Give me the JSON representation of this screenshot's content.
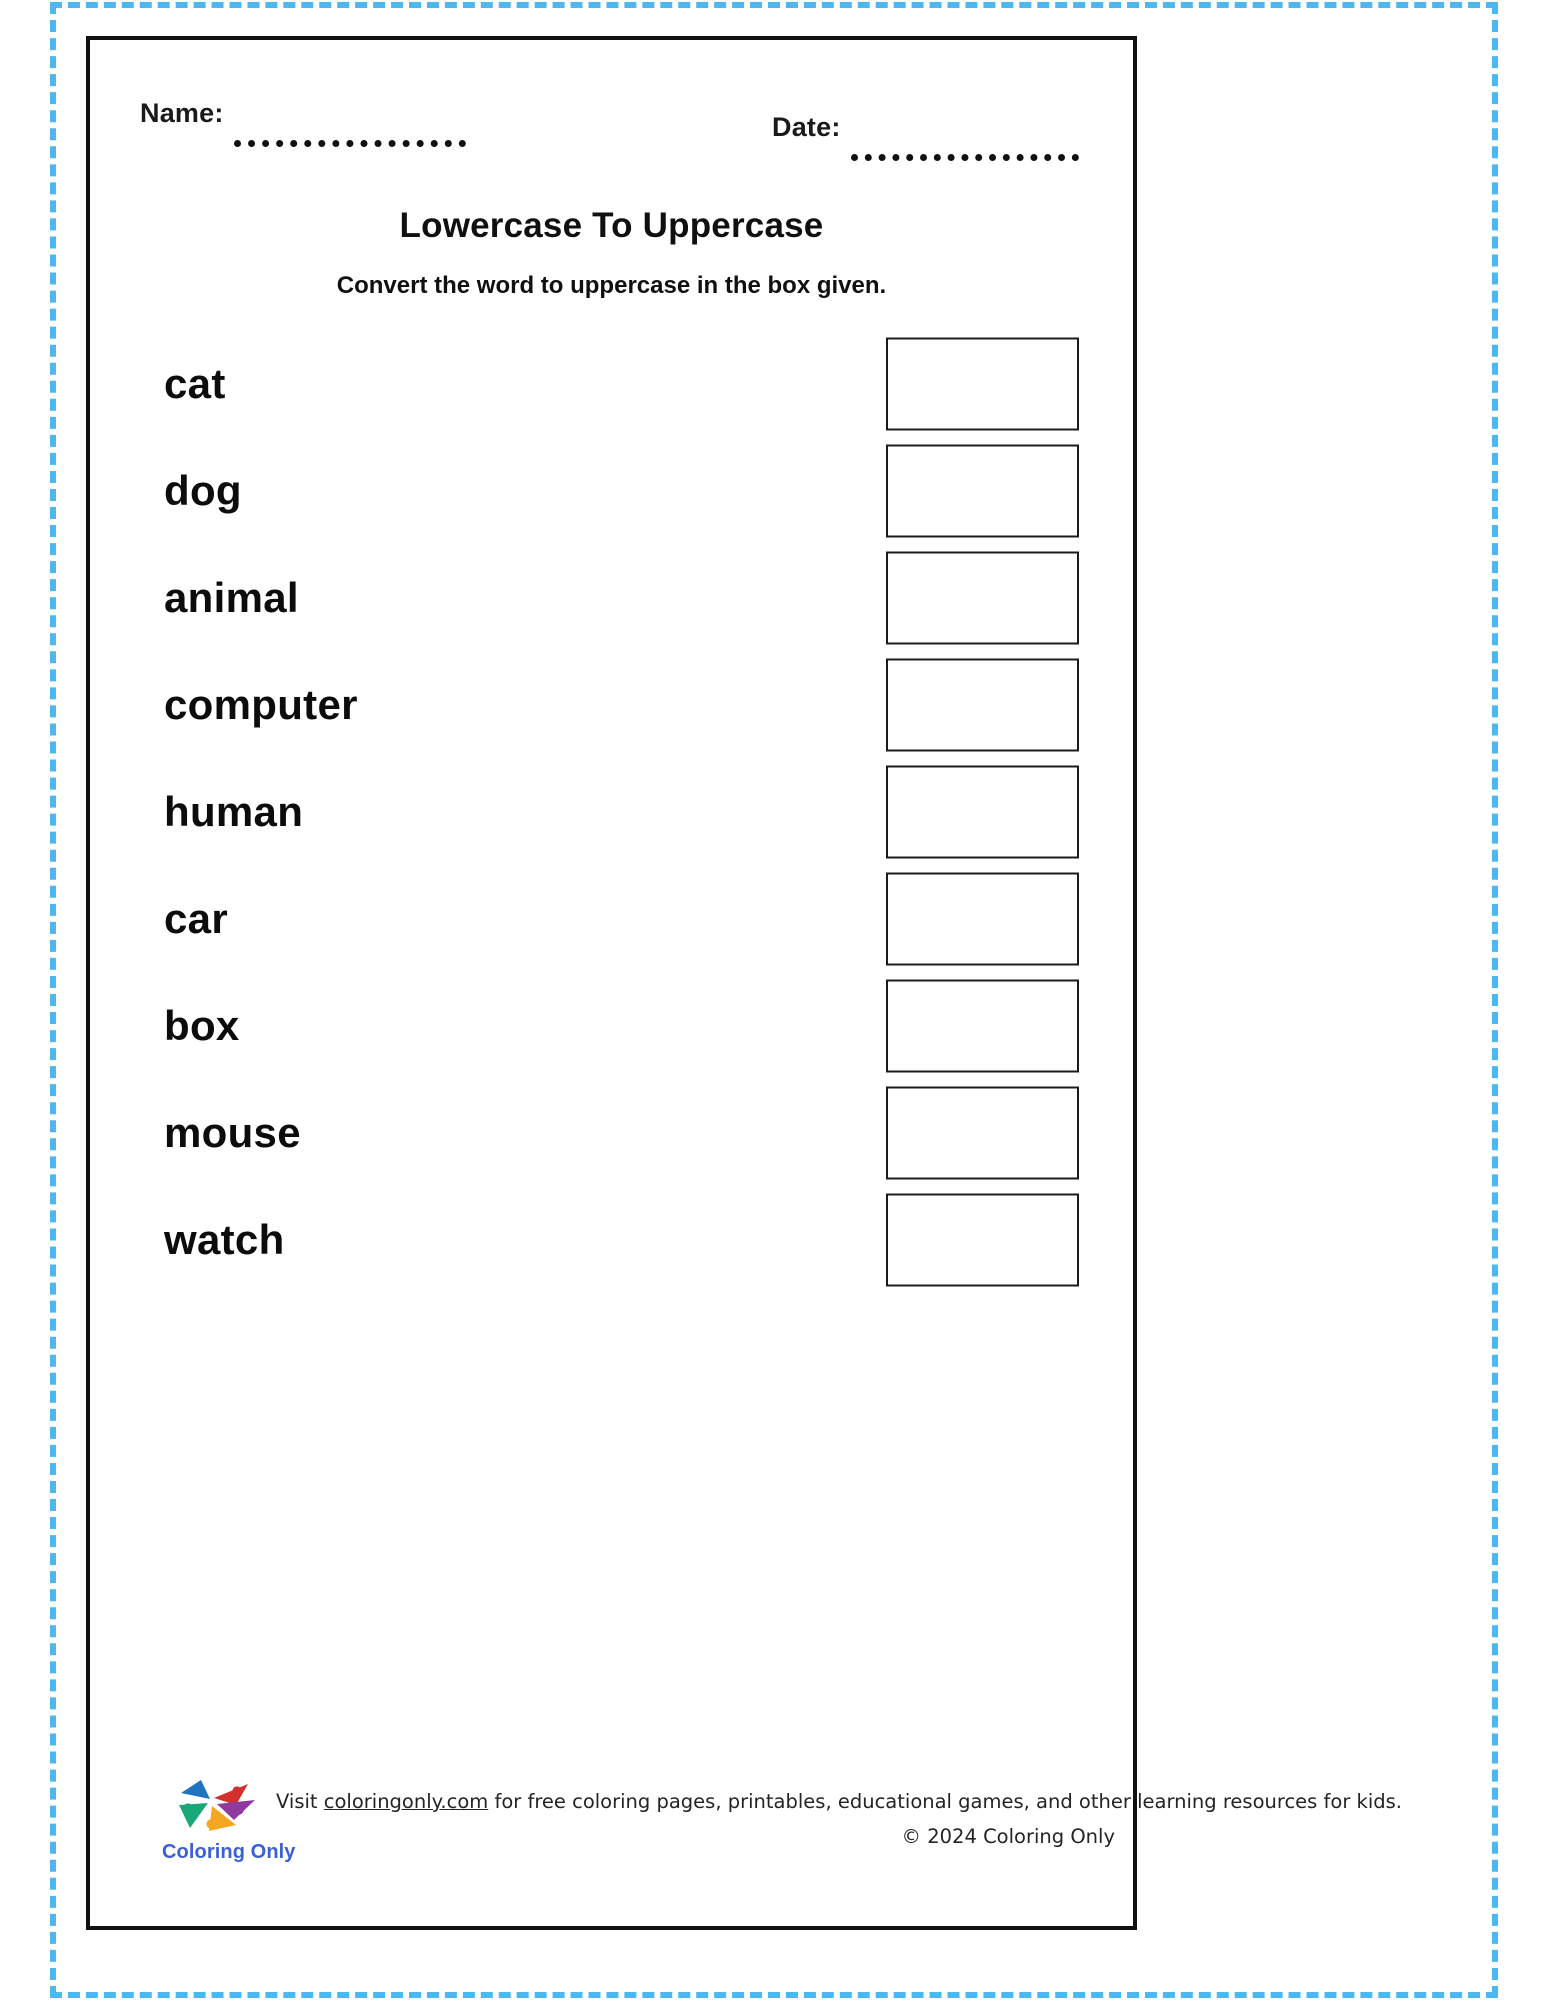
{
  "page": {
    "frame_accent_color": "#4db7f0",
    "frame_color": "#111111"
  },
  "header": {
    "name_label": "Name:",
    "date_label": "Date:",
    "name_value": "",
    "date_value": ""
  },
  "title_block": {
    "title": "Lowercase To Uppercase",
    "subtitle": "Convert the word to uppercase in the box given."
  },
  "exercises": [
    {
      "word": "cat",
      "answer": ""
    },
    {
      "word": "dog",
      "answer": ""
    },
    {
      "word": "animal",
      "answer": ""
    },
    {
      "word": "computer",
      "answer": ""
    },
    {
      "word": "human",
      "answer": ""
    },
    {
      "word": "car",
      "answer": ""
    },
    {
      "word": "box",
      "answer": ""
    },
    {
      "word": "mouse",
      "answer": ""
    },
    {
      "word": "watch",
      "answer": ""
    }
  ],
  "footer": {
    "logo_name": "coloring-only-logo",
    "brand_name": "Coloring Only",
    "visit_prefix": "Visit ",
    "site_link": "coloringonly.com",
    "visit_suffix": " for free coloring pages, printables, educational games, and other learning resources for kids.",
    "copyright": "© 2024 Coloring Only",
    "brand_color": "#3b5fd6",
    "logo_colors": [
      "#d32f2f",
      "#8e3a9e",
      "#f5a623",
      "#1aa87a",
      "#1f74c0"
    ]
  }
}
